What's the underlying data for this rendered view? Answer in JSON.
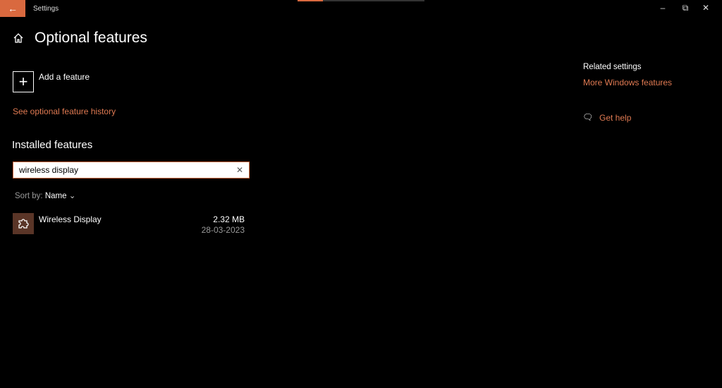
{
  "window": {
    "title": "Settings",
    "back_icon": "arrow-left-icon",
    "progress_percent": 20,
    "accent": "#d9693f"
  },
  "page": {
    "title": "Optional features"
  },
  "add_feature": {
    "label": "Add a feature"
  },
  "history_link": "See optional feature history",
  "installed": {
    "heading": "Installed features",
    "search_value": "wireless display",
    "sort_label": "Sort by:",
    "sort_value": "Name",
    "items": [
      {
        "name": "Wireless Display",
        "size": "2.32 MB",
        "date": "28-03-2023",
        "icon": "puzzle-piece-icon"
      }
    ]
  },
  "related": {
    "heading": "Related settings",
    "more_link": "More Windows features",
    "help_link": "Get help"
  }
}
